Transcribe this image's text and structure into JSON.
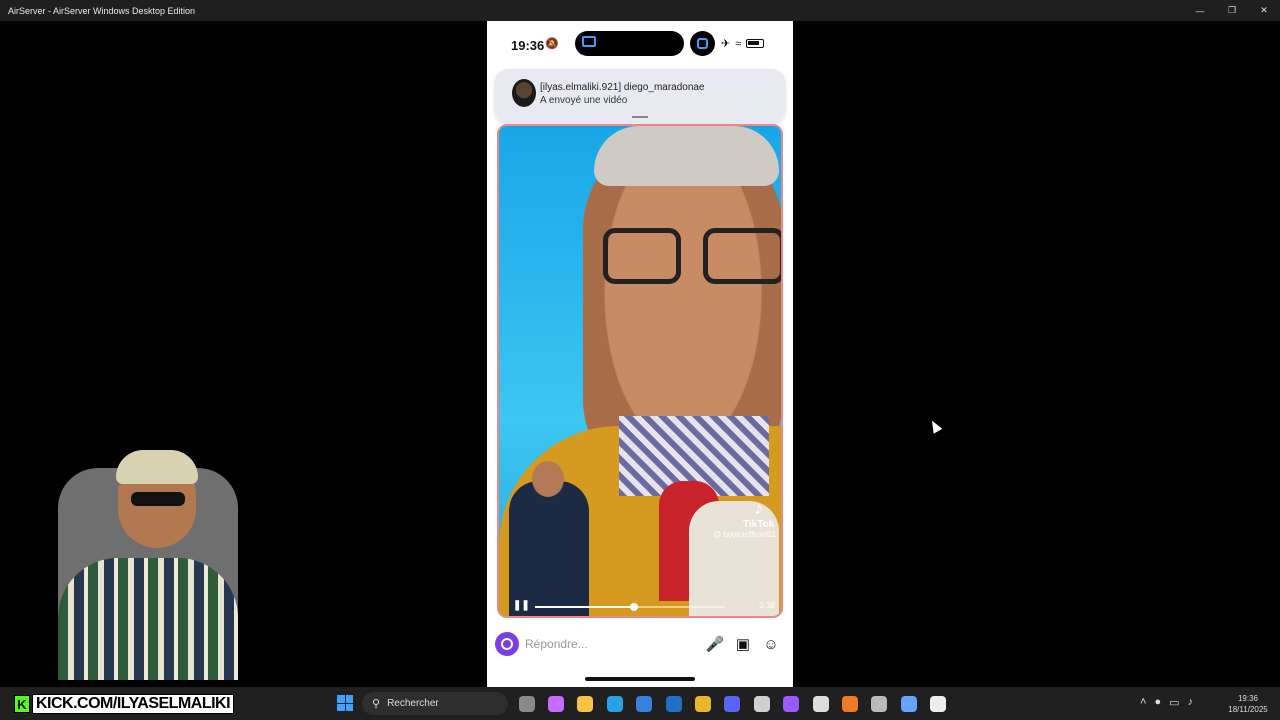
{
  "window": {
    "title": "AirServer - AirServer Windows Desktop Edition",
    "controls": [
      "minimize-icon",
      "restore-icon",
      "close-icon"
    ]
  },
  "phone": {
    "status": {
      "time": "19:36",
      "icons": [
        "bell-slash-icon",
        "airplay-icon",
        "screen-mirror-icon",
        "airplane-icon",
        "wifi-icon",
        "battery-icon"
      ]
    },
    "notification": {
      "line1": "[ilyas.elmaliki.921] diego_maradonae",
      "line2": "A envoyé une vidéo"
    },
    "video": {
      "watermark": "TikTok",
      "handle": "@ boykaofficiel01",
      "elapsed": "0:38",
      "progress_fraction": 0.52
    },
    "reply": {
      "placeholder": "Répondre...",
      "icons": [
        "camera-icon",
        "microphone-icon",
        "image-icon",
        "sticker-icon"
      ]
    }
  },
  "overlay": {
    "kick_logo": "K",
    "kick_url": "KICK.COM/ILYASELMALIKI"
  },
  "taskbar": {
    "search_text": "Rechercher",
    "apps": [
      {
        "name": "task-view-icon",
        "color": "#8a8a8a"
      },
      {
        "name": "copilot-icon",
        "color": "#c46bff"
      },
      {
        "name": "file-explorer-icon",
        "color": "#f4c542"
      },
      {
        "name": "edge-icon",
        "color": "#2aa0e6"
      },
      {
        "name": "store-icon",
        "color": "#3b7fe0"
      },
      {
        "name": "outlook-icon",
        "color": "#1f6fc7"
      },
      {
        "name": "chrome-icon",
        "color": "#e9b52a"
      },
      {
        "name": "discord-icon",
        "color": "#5865f2"
      },
      {
        "name": "airserver-icon",
        "color": "#cfcfcf"
      },
      {
        "name": "game-icon",
        "color": "#9b59ff"
      },
      {
        "name": "obs-icon",
        "color": "#dddddd"
      },
      {
        "name": "app-icon",
        "color": "#f07b24"
      },
      {
        "name": "media-icon",
        "color": "#bbbbbb"
      },
      {
        "name": "steam-icon",
        "color": "#66a3ff"
      },
      {
        "name": "capcut-icon",
        "color": "#eeeeee"
      }
    ],
    "tray_icons": [
      "chevron-up-icon",
      "microphone-icon",
      "display-icon",
      "speaker-icon"
    ],
    "time": "19:36",
    "date": "18/11/2025"
  }
}
